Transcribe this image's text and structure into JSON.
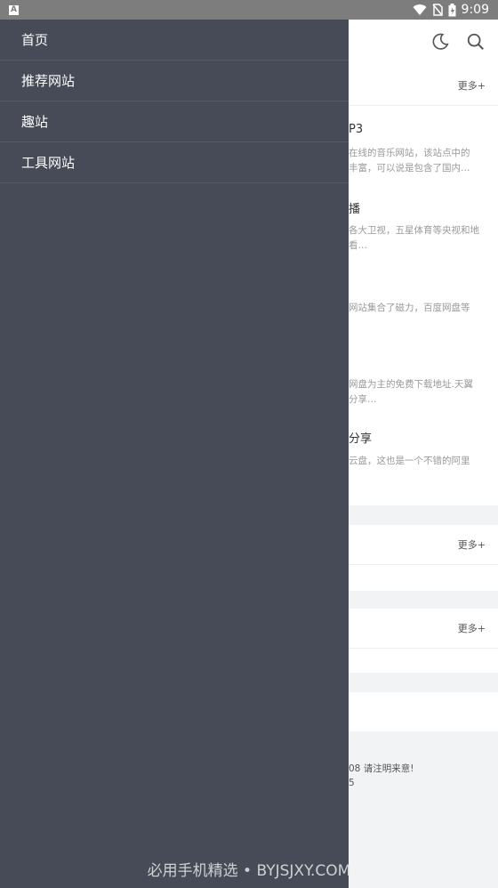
{
  "status_bar": {
    "time": "9:09"
  },
  "drawer": {
    "items": [
      {
        "label": "首页"
      },
      {
        "label": "推荐网站"
      },
      {
        "label": "趣站"
      },
      {
        "label": "工具网站"
      }
    ]
  },
  "background": {
    "section1": {
      "more": "更多+",
      "items": [
        {
          "title": "P3",
          "desc1": "在线的音乐网站，该站点中的",
          "desc2": "丰富，可以说是包含了国内…"
        },
        {
          "title": "播",
          "desc1": "各大卫视，五星体育等央视和地",
          "desc2": "看…"
        },
        {
          "title": "",
          "desc1": "网站集合了磁力，百度网盘等",
          "desc2": ""
        },
        {
          "title": "",
          "desc1": "网盘为主的免费下载地址.天翼",
          "desc2": "分享…"
        },
        {
          "title": "分享",
          "desc1": "云盘，这也是一个不错的阿里",
          "desc2": ""
        }
      ]
    },
    "section2": {
      "more": "更多+"
    },
    "section3": {
      "more": "更多+"
    },
    "footer": {
      "line1": "08 请注明来意!",
      "line2": "5"
    }
  },
  "watermark": "必用手机精选 • BYJSJXY.COM"
}
